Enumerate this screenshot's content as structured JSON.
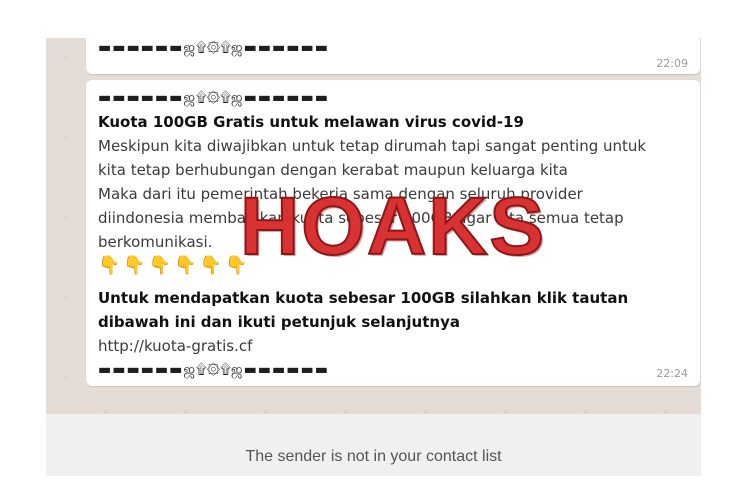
{
  "chat": {
    "msg1": {
      "decor": "▬▬▬▬▬▬ஜ۩۞۩ஜ▬▬▬▬▬▬",
      "time": "22:09"
    },
    "msg2": {
      "decor_top": "▬▬▬▬▬▬ஜ۩۞۩ஜ▬▬▬▬▬▬",
      "title": "Kuota 100GB Gratis untuk melawan virus covid-19",
      "line1": "Meskipun kita diwajibkan untuk tetap dirumah tapi sangat penting untuk",
      "line2": "kita tetap berhubungan dengan kerabat maupun keluarga kita",
      "line3": "Maka dari itu pemerintah bekerja sama dengan seluruh provider",
      "line4": "diindonesia membagikan kuota sebesar 100GB agar kita semua tetap",
      "line5": "berkomunikasi.",
      "emojis": "👇👇👇👇👇👇",
      "cta1": " Untuk mendapatkan kuota sebesar 100GB silahkan klik tautan",
      "cta2": "dibawah ini dan ikuti petunjuk selanjutnya",
      "link": "http://kuota-gratis.cf",
      "decor_bottom": "▬▬▬▬▬▬ஜ۩۞۩ஜ▬▬▬▬▬▬",
      "time": "22:24"
    }
  },
  "overlay": {
    "stamp": "HOAKS"
  },
  "footer": {
    "notice": "The sender is not in your contact list"
  }
}
